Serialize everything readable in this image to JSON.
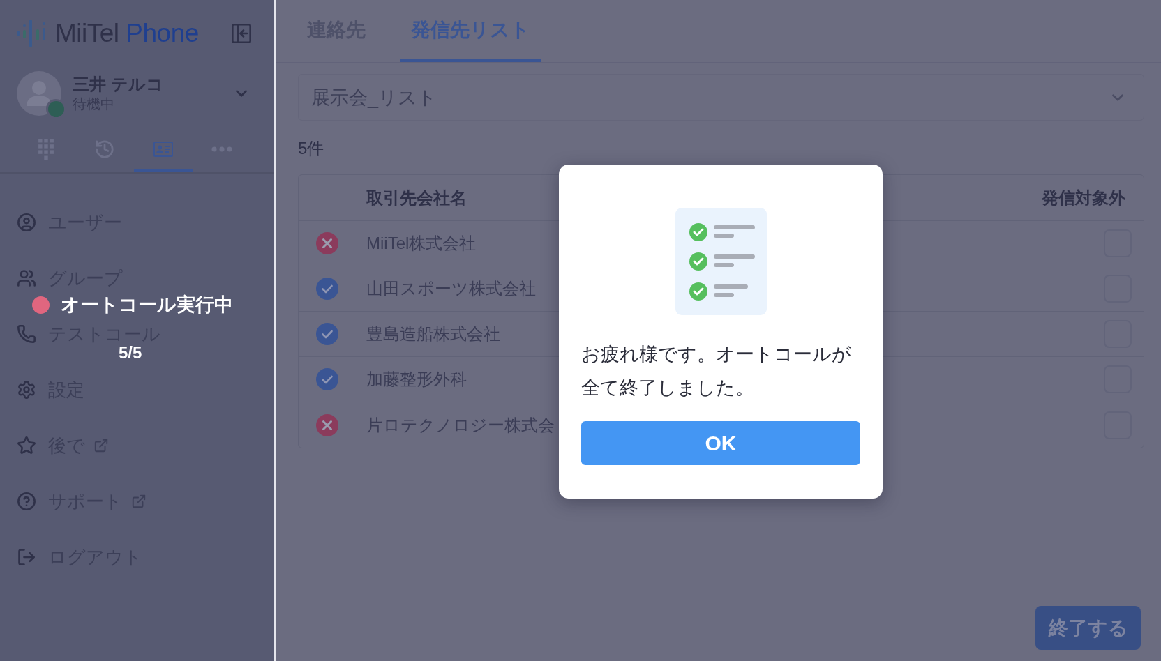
{
  "sidebar": {
    "logo": {
      "primary": "MiiTel",
      "secondary": "Phone"
    },
    "user": {
      "name": "三井 テルコ",
      "status": "待機中"
    },
    "nav_tabs": [
      {
        "selected": false
      },
      {
        "selected": false
      },
      {
        "selected": true
      },
      {
        "selected": false
      }
    ],
    "menu": [
      {
        "label": "ユーザー",
        "external": false
      },
      {
        "label": "グループ",
        "external": false
      },
      {
        "label": "テストコール",
        "external": false
      },
      {
        "label": "設定",
        "external": false
      },
      {
        "label": "後で",
        "external": true
      },
      {
        "label": "サポート",
        "external": true
      },
      {
        "label": "ログアウト",
        "external": false
      }
    ],
    "autocall": {
      "label": "オートコール実行中",
      "progress": "5/5"
    }
  },
  "tabs": [
    {
      "label": "連絡先",
      "selected": false
    },
    {
      "label": "発信先リスト",
      "selected": true
    }
  ],
  "list_select": {
    "value": "展示会_リスト"
  },
  "count": "5件",
  "table": {
    "columns": [
      "取引先会社名",
      "発信対象外"
    ],
    "rows": [
      {
        "completed": false,
        "company": "MiiTel株式会社",
        "excluded": false
      },
      {
        "completed": true,
        "company": "山田スポーツ株式会社",
        "excluded": false
      },
      {
        "completed": true,
        "company": "豊島造船株式会社",
        "excluded": false
      },
      {
        "completed": true,
        "company": "加藤整形外科",
        "excluded": false
      },
      {
        "completed": false,
        "company": "片ロテクノロジー株式会",
        "excluded": false
      }
    ]
  },
  "end_button": {
    "label": "終了する"
  },
  "dialog": {
    "message": "お疲れ様です。オートコールが全て終了しました。",
    "button": "OK"
  }
}
